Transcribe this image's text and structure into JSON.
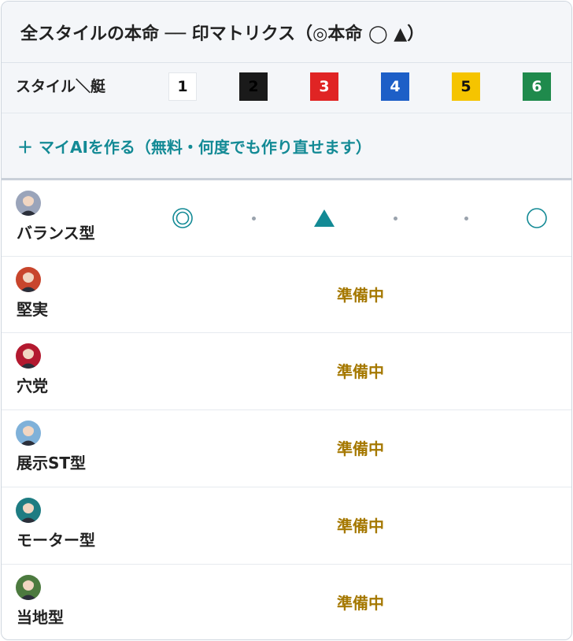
{
  "title": "全スタイルの本命 ── 印マトリクス（◎本命 ◯ ▲）",
  "header": {
    "style_label": "スタイル＼艇",
    "lanes": [
      {
        "label": "1",
        "bg": "#ffffff",
        "fg": "#111111"
      },
      {
        "label": "2",
        "bg": "#1a1a1a",
        "fg": "#000000"
      },
      {
        "label": "3",
        "bg": "#e02424",
        "fg": "#ffffff"
      },
      {
        "label": "4",
        "bg": "#1d5fc7",
        "fg": "#ffffff"
      },
      {
        "label": "5",
        "bg": "#f5c400",
        "fg": "#111111"
      },
      {
        "label": "6",
        "bg": "#1f8a4c",
        "fg": "#ffffff"
      }
    ]
  },
  "add_ai": {
    "label": "＋ マイAIを作る（無料・何度でも作り直せます）"
  },
  "accent_color": "#138a95",
  "status_color": "#a57800",
  "rows": [
    {
      "name": "バランス型",
      "avatar_color": "#9aa4ba",
      "marks": [
        "double-circle",
        "dot",
        "triangle",
        "dot",
        "dot",
        "circle"
      ],
      "status": ""
    },
    {
      "name": "堅実",
      "avatar_color": "#c8452c",
      "marks": [],
      "status": "準備中"
    },
    {
      "name": "穴党",
      "avatar_color": "#b3192f",
      "marks": [],
      "status": "準備中"
    },
    {
      "name": "展示ST型",
      "avatar_color": "#7fb1d9",
      "marks": [],
      "status": "準備中"
    },
    {
      "name": "モーター型",
      "avatar_color": "#1e7c82",
      "marks": [],
      "status": "準備中"
    },
    {
      "name": "当地型",
      "avatar_color": "#4c7a3f",
      "marks": [],
      "status": "準備中"
    }
  ]
}
